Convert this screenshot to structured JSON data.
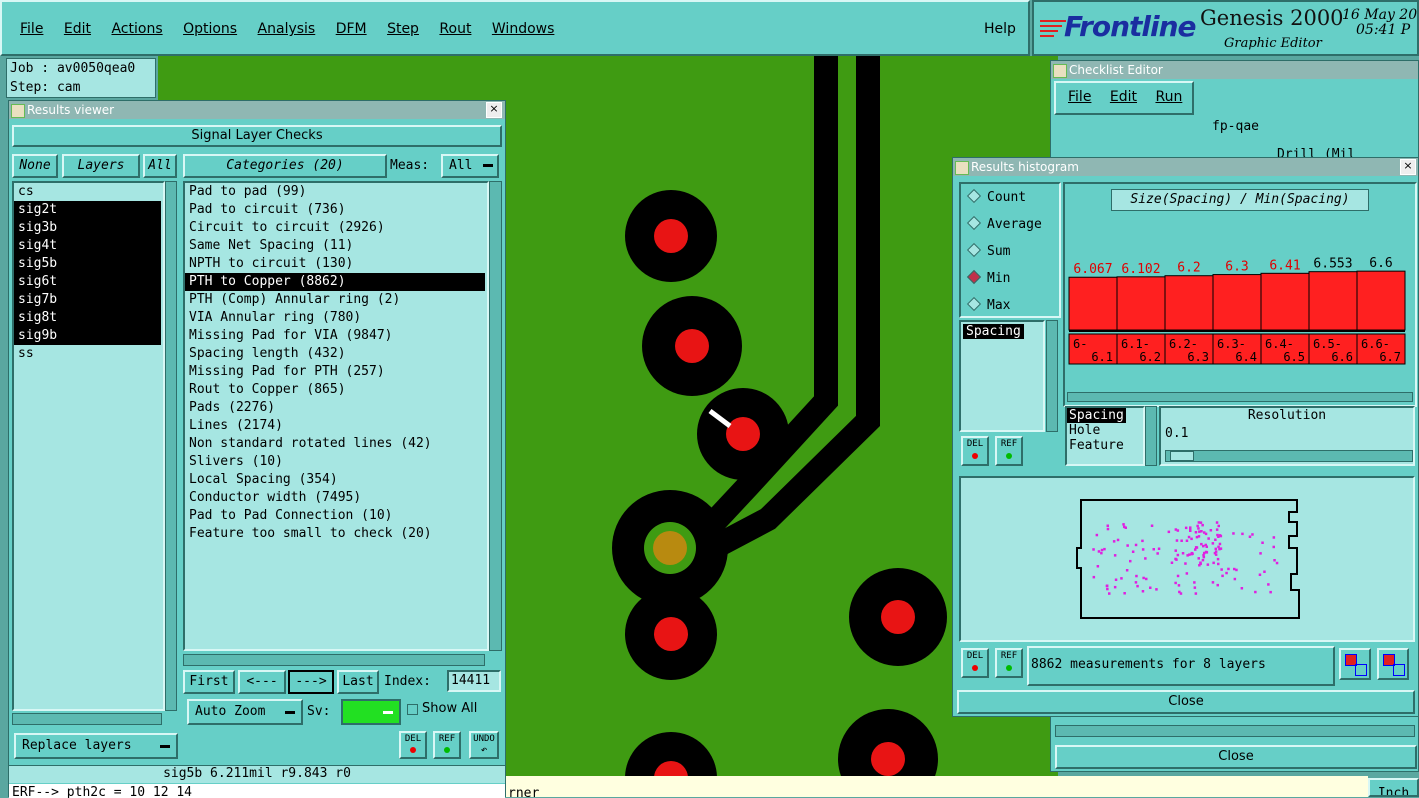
{
  "menubar": {
    "items": [
      "File",
      "Edit",
      "Actions",
      "Options",
      "Analysis",
      "DFM",
      "Step",
      "Rout",
      "Windows"
    ],
    "help": "Help"
  },
  "branding": {
    "logo": "Frontline",
    "product": "Genesis 2000",
    "subtitle": "Graphic Editor",
    "date": "16 May 20",
    "time": "05:41 P"
  },
  "job": {
    "job_label": "Job : av0050qea0",
    "step_label": "Step: cam"
  },
  "results_viewer": {
    "title": "Results viewer",
    "header": "Signal Layer Checks",
    "none_btn": "None",
    "layers_btn": "Layers",
    "all_btn": "All",
    "categories_btn": "Categories (20)",
    "meas_label": "Meas:",
    "meas_value": "All",
    "layers": [
      {
        "name": "cs",
        "selected": false
      },
      {
        "name": "sig2t",
        "selected": true
      },
      {
        "name": "sig3b",
        "selected": true
      },
      {
        "name": "sig4t",
        "selected": true
      },
      {
        "name": "sig5b",
        "selected": true
      },
      {
        "name": "sig6t",
        "selected": true
      },
      {
        "name": "sig7b",
        "selected": true
      },
      {
        "name": "sig8t",
        "selected": true
      },
      {
        "name": "sig9b",
        "selected": true
      },
      {
        "name": "ss",
        "selected": false
      }
    ],
    "categories": [
      {
        "label": "Pad to pad (99)",
        "selected": false
      },
      {
        "label": "Pad to circuit (736)",
        "selected": false
      },
      {
        "label": "Circuit to circuit (2926)",
        "selected": false
      },
      {
        "label": "Same Net Spacing (11)",
        "selected": false
      },
      {
        "label": "NPTH to circuit (130)",
        "selected": false
      },
      {
        "label": "PTH to Copper (8862)",
        "selected": true
      },
      {
        "label": "PTH (Comp) Annular ring (2)",
        "selected": false
      },
      {
        "label": "VIA Annular ring (780)",
        "selected": false
      },
      {
        "label": "Missing Pad for VIA (9847)",
        "selected": false
      },
      {
        "label": "Spacing length (432)",
        "selected": false
      },
      {
        "label": "Missing Pad for PTH (257)",
        "selected": false
      },
      {
        "label": "Rout to Copper (865)",
        "selected": false
      },
      {
        "label": "Pads (2276)",
        "selected": false
      },
      {
        "label": "Lines (2174)",
        "selected": false
      },
      {
        "label": "Non standard rotated lines (42)",
        "selected": false
      },
      {
        "label": "Slivers (10)",
        "selected": false
      },
      {
        "label": "Local Spacing (354)",
        "selected": false
      },
      {
        "label": "Conductor width (7495)",
        "selected": false
      },
      {
        "label": "Pad to Pad Connection (10)",
        "selected": false
      },
      {
        "label": "Feature too small to check (20)",
        "selected": false
      }
    ],
    "nav": {
      "first": "First",
      "prev": "<---",
      "next": "--->",
      "last": "Last",
      "index_label": "Index:",
      "index_value": "14411"
    },
    "auto_zoom": "Auto Zoom",
    "sv_label": "Sv:",
    "show_all": "Show All",
    "replace_layers": "Replace layers",
    "del": "DEL",
    "ref": "REF",
    "undo": "UNDO",
    "status": "sig5b 6.211mil  r9.843  r0",
    "erf": "ERF--> pth2c = 10 12 14"
  },
  "checklist_editor": {
    "title": "Checklist Editor",
    "menu": [
      "File",
      "Edit",
      "Run"
    ],
    "name": "fp-qae",
    "drill_partial": "Drill (Mil",
    "close": "Close"
  },
  "histogram": {
    "title": "Results histogram",
    "modes": [
      {
        "label": "Count",
        "checked": false
      },
      {
        "label": "Average",
        "checked": false
      },
      {
        "label": "Sum",
        "checked": false
      },
      {
        "label": "Min",
        "checked": true
      },
      {
        "label": "Max",
        "checked": false
      }
    ],
    "list_selected": "Spacing",
    "chart_title": "Size(Spacing) / Min(Spacing)",
    "bar_color": "#ff2020",
    "value_color_red": "#e00000",
    "resolution_label": "Resolution",
    "resolution_value": "0.1",
    "attr_list": [
      "Spacing",
      "Hole",
      "Feature"
    ],
    "measurements": "8862 measurements for 8 layers",
    "close": "Close",
    "del": "DEL",
    "ref": "REF"
  },
  "chart_data": {
    "type": "bar",
    "title": "Size(Spacing) / Min(Spacing)",
    "categories": [
      "6-6.1",
      "6.1-6.2",
      "6.2-6.3",
      "6.3-6.4",
      "6.4-6.5",
      "6.5-6.6",
      "6.6-6.7"
    ],
    "category_top": [
      "6-",
      "6.1-",
      "6.2-",
      "6.3-",
      "6.4-",
      "6.5-",
      "6.6-"
    ],
    "category_bottom": [
      "6.1",
      "6.2",
      "6.3",
      "6.4",
      "6.5",
      "6.6",
      "6.7"
    ],
    "values": [
      6.067,
      6.102,
      6.2,
      6.3,
      6.41,
      6.553,
      6.6
    ],
    "value_labels": [
      "6.067",
      "6.102",
      "6.2",
      "6.3",
      "6.41",
      "6.553",
      "6.6"
    ],
    "label_red": [
      true,
      true,
      true,
      true,
      true,
      false,
      false
    ]
  },
  "bottom": {
    "corner_text": "rner",
    "units": "Inch"
  }
}
